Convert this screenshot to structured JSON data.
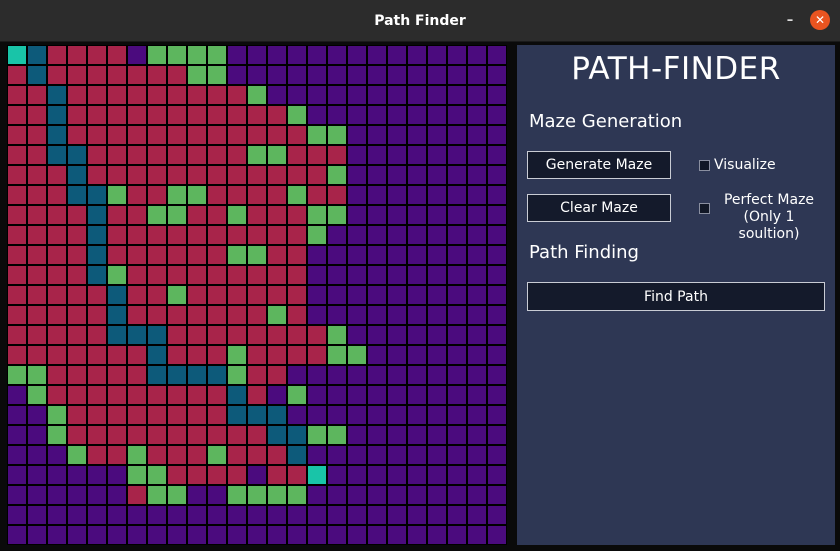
{
  "window": {
    "title": "Path Finder",
    "minimize_glyph": "–",
    "close_glyph": "✕"
  },
  "panel": {
    "title": "PATH-FINDER",
    "maze_generation": {
      "heading": "Maze Generation",
      "generate_label": "Generate Maze",
      "clear_label": "Clear Maze",
      "visualize": {
        "label": "Visualize",
        "checked": false
      },
      "perfect_maze": {
        "line1": "Perfect Maze",
        "line2": "(Only 1 soultion)",
        "checked": false
      }
    },
    "path_finding": {
      "heading": "Path Finding",
      "find_label": "Find Path"
    }
  },
  "colors": {
    "unvisited": "#4b0b7e",
    "visited": "#a8244a",
    "frontier": "#5db65e",
    "path": "#0d5a7a",
    "endpoint": "#19c4a8",
    "wall": "#000000",
    "panel": "#2e3754",
    "button": "#141a2b"
  },
  "maze": {
    "rows": 25,
    "cols": 25,
    "legend": "U=unvisited V=visited F=frontier P=path E=start/end",
    "grid": [
      "EPVVVVUFFFFUUUUUUUUUUUUUU",
      "VPVVVVVVVFFUUUUUUUUUUUUUU",
      "VVPVVVVVVVVVFUUUUUUUUUUUU",
      "VVPVVVVVVVVVVVFUUUUUUUUUU",
      "VVPVVVVVVVVVVVVFFUUUUUUUU",
      "VVPPVVVVVVVVFFVVVUUUUUUUU",
      "VVVPVVVVVVVVVVVVFUUUUUUUU",
      "VVVPPFVVFFVVVVFVVUUUUUUUU",
      "VVVVPVVFFVVFVVVFFUUUUUUUU",
      "VVVVPVVVVVVVVVVFUUUUUUUUU",
      "VVVVPVVVVVVFFVVUUUUUUUUUU",
      "VVVVPFVVVVVVVVVUUUUUUUUUU",
      "VVVVVPVVFVVVVVVUUUUUUUUUU",
      "VVVVVPVVVVVVVFVUUUUUUUUUU",
      "VVVVVPPPVVVVVVVVFUUUUUUUU",
      "VVVVVVVPVVVFVVVVFFUUUUUUU",
      "FFVVVVVPPPPFVVUUUUUUUUUUU",
      "UFVVVVVVVVVPVUFUUUUUUUUUU",
      "UUFVVVVVVVVPPPUUUUUUUUUUU",
      "UUFVVVVVVVVVVPPFFUUUUUUUU",
      "UUUFVVFVVVFVVVPUUUUUUUUUU",
      "UUUUUUFFVVVVUVVEUUUUUUUUU",
      "UUUUUUVFFUUFFFFUUUUUUUUUU",
      "UUUUUUUUUUUUUUUUUUUUUUUUU",
      "UUUUUUUUUUUUUUUUUUUUUUUUU"
    ]
  }
}
